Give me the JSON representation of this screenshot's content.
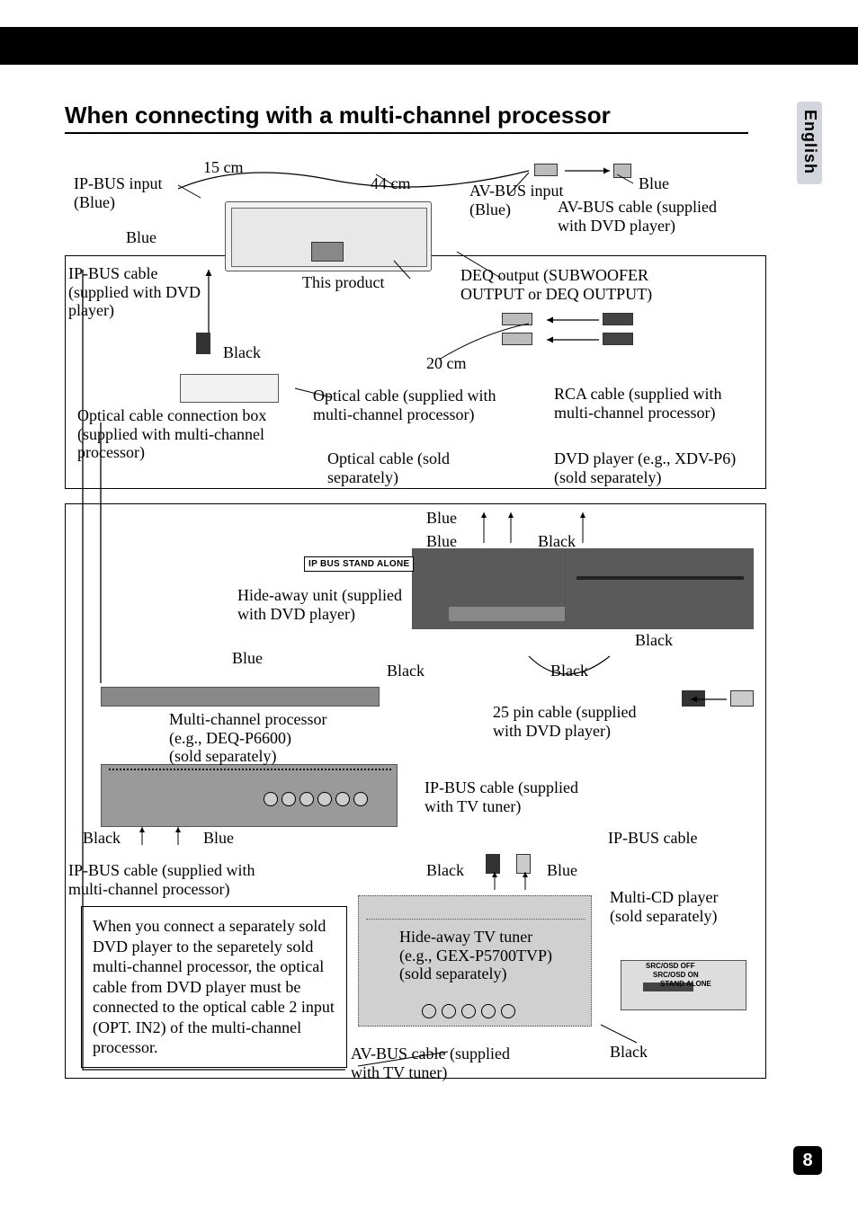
{
  "page": {
    "language_tab": "English",
    "page_number": "8",
    "section_title": "When connecting with a multi-channel processor"
  },
  "labels": {
    "len_15cm": "15 cm",
    "len_44cm": "44 cm",
    "len_20cm": "20 cm",
    "ipbus_input": "IP-BUS input\n(Blue)",
    "blue_top_left": "Blue",
    "ipbus_cable_dvd": "IP-BUS cable\n(supplied with DVD\nplayer)",
    "this_product": "This product",
    "avbus_input": "AV-BUS input\n(Blue)",
    "blue_top_right": "Blue",
    "avbus_cable_dvd": "AV-BUS cable (supplied\nwith DVD player)",
    "deq_output": "DEQ output (SUBWOOFER\nOUTPUT or DEQ OUTPUT)",
    "black_upper": "Black",
    "optical_box": "Optical cable connection box\n(supplied with multi-channel\nprocessor)",
    "optical_supplied": "Optical cable (supplied with\nmulti-channel processor)",
    "optical_sold": "Optical cable (sold\nseparately)",
    "rca_cable": "RCA cable (supplied with\nmulti-channel processor)",
    "dvd_player_ex": "DVD player (e.g., XDV-P6)\n(sold separately)",
    "blue_mid1": "Blue",
    "blue_mid2": "Blue",
    "black_mid1": "Black",
    "hideaway_dvd": "Hide-away unit (supplied\nwith DVD player)",
    "blue_bottom_left": "Blue",
    "black_mid2": "Black",
    "black_mid3": "Black",
    "black_right": "Black",
    "pin25_cable": "25 pin cable (supplied\nwith DVD player)",
    "multi_proc": "Multi-channel processor\n(e.g., DEQ-P6600)\n(sold separately)",
    "black_bl": "Black",
    "blue_bl": "Blue",
    "ipbus_tv": "IP-BUS cable (supplied\nwith TV tuner)",
    "ipbus_cable_plain": "IP-BUS cable",
    "ipbus_cable_mcp": "IP-BUS cable (supplied with\nmulti-channel processor)",
    "black_bot": "Black",
    "blue_bot": "Blue",
    "multi_cd": "Multi-CD player\n(sold separately)",
    "hideaway_tv": "Hide-away TV tuner\n(e.g., GEX-P5700TVP)\n(sold separately)",
    "avbus_tv": "AV-BUS cable (supplied\nwith TV tuner)",
    "black_very_bot": "Black",
    "ipbus_standalone": "IP BUS      STAND ALONE",
    "switch_src_osd_off": "SRC/OSD OFF",
    "switch_src_osd_on": "SRC/OSD ON",
    "switch_stand_alone": "STAND ALONE"
  },
  "note": "When you connect a separately sold DVD player to the separetely sold multi-channel processor, the optical cable from DVD player must be connected to the optical cable 2 input (OPT. IN2) of the multi-channel processor."
}
